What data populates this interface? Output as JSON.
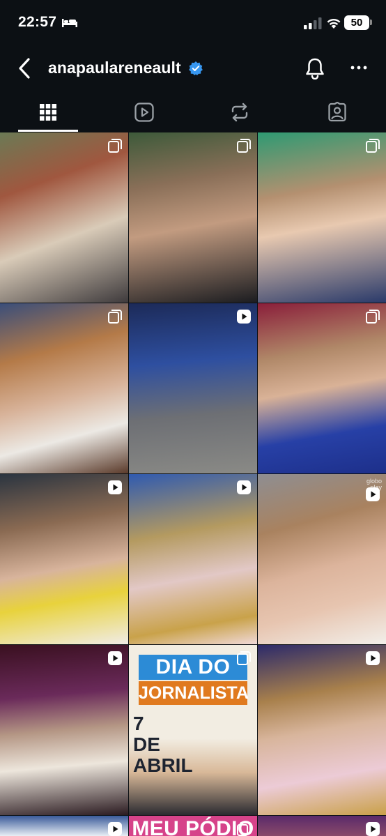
{
  "status_bar": {
    "time": "22:57",
    "battery": "50"
  },
  "profile": {
    "username": "anapaulareneault",
    "verified": true
  },
  "icons": {
    "back": "chevron-left-icon",
    "verified": "verified-badge-icon",
    "bell": "bell-icon",
    "more": "more-horizontal-icon",
    "grid": "grid-icon",
    "reels": "reels-icon",
    "reposts": "repost-icon",
    "tagged": "tagged-icon",
    "carousel": "carousel-icon",
    "video": "video-icon"
  },
  "tabs": [
    {
      "name": "posts-grid",
      "active": true
    },
    {
      "name": "reels",
      "active": false
    },
    {
      "name": "reposts",
      "active": false
    },
    {
      "name": "tagged",
      "active": false
    }
  ],
  "posts": [
    {
      "type": "carousel",
      "description": "woman in white tee on couch"
    },
    {
      "type": "carousel",
      "description": "woman with glasses lying down"
    },
    {
      "type": "carousel",
      "description": "woman laughing"
    },
    {
      "type": "carousel",
      "description": "woman in white top with drink"
    },
    {
      "type": "video",
      "description": "dancing on colorful stage"
    },
    {
      "type": "carousel",
      "description": "woman in blue shirt"
    },
    {
      "type": "video",
      "description": "woman crying with tissue"
    },
    {
      "type": "video",
      "description": "woman in pink pajamas sitting"
    },
    {
      "type": "video",
      "description": "close-up woman smiling",
      "watermark": "globo\nplay"
    },
    {
      "type": "video",
      "description": "woman posing in white suit"
    },
    {
      "type": "carousel",
      "description": "journalist day poster",
      "text_lines": [
        "DIA DO",
        "JORNALISTA",
        "7 DE",
        "ABRIL"
      ]
    },
    {
      "type": "video",
      "description": "woman in pink pajamas gesturing"
    },
    {
      "type": "video",
      "description": "partial post"
    },
    {
      "type": "carousel",
      "description": "partial post",
      "text_lines": [
        "MEU PÓDIO"
      ]
    },
    {
      "type": "video",
      "description": "partial post"
    }
  ],
  "colors": {
    "background": "#0c1014",
    "verified": "#3797f0",
    "text": "#ffffff"
  }
}
